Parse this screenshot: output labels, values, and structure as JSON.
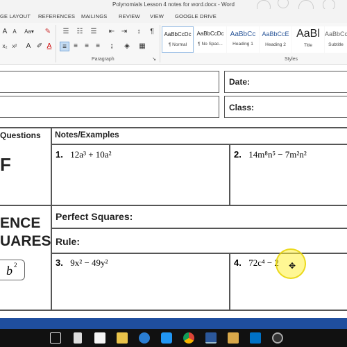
{
  "window": {
    "title": "Polynomials Lesson 4 notes for word.docx - Word"
  },
  "tabs": [
    "GE LAYOUT",
    "REFERENCES",
    "MAILINGS",
    "REVIEW",
    "VIEW",
    "GOOGLE DRIVE"
  ],
  "ribbon": {
    "paragraph_label": "Paragraph",
    "styles_label": "Styles",
    "styles": [
      {
        "sample": "AaBbCcDc",
        "name": "¶ Normal"
      },
      {
        "sample": "AaBbCcDc",
        "name": "¶ No Spac..."
      },
      {
        "sample": "AaBbCc",
        "name": "Heading 1"
      },
      {
        "sample": "AaBbCcE",
        "name": "Heading 2"
      },
      {
        "sample": "AaBl",
        "name": "Title"
      },
      {
        "sample": "AaBbCcD",
        "name": "Subtitle"
      }
    ]
  },
  "document": {
    "date_label": "Date:",
    "class_label": "Class:",
    "questions_header": "Questions",
    "notes_header": "Notes/Examples",
    "left_f": "F",
    "left_ence": "ENCE",
    "left_uares": "UARES",
    "left_b2": "b",
    "left_b2_exp": "2",
    "perfect_squares": "Perfect Squares:",
    "rule": "Rule:",
    "problems": [
      {
        "num": "1.",
        "expr": "12a³ + 10a²"
      },
      {
        "num": "2.",
        "expr": "14m⁸n⁵ − 7m²n²"
      },
      {
        "num": "3.",
        "expr": "9x² − 49y²"
      },
      {
        "num": "4.",
        "expr": "72c⁴ − 2"
      }
    ]
  }
}
